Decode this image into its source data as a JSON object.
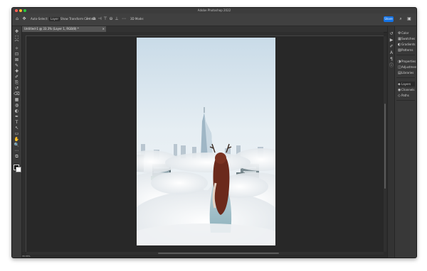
{
  "window": {
    "title": "Adobe Photoshop 2022"
  },
  "options_bar": {
    "left_icons": [
      "home-icon",
      "move-tool-icon"
    ],
    "auto_select_label": "Auto-Select:",
    "layer_value": "Layer",
    "transform_label": "Show Transform Controls",
    "align_icons": [
      "align-left-icon",
      "align-center-icon",
      "align-right-icon",
      "align-top-icon",
      "align-middle-icon",
      "align-bottom-icon",
      "more-icon"
    ],
    "mode_3d_label": "3D Mode:",
    "share_label": "Share",
    "right_icons": [
      "search-icon",
      "workspace-icon"
    ]
  },
  "document_tab": {
    "label": "Untitled-1 @ 33.3% (Layer 1, RGB/8) *",
    "close": "×"
  },
  "tools": [
    "move-tool",
    "marquee-tool",
    "lasso-tool",
    "magic-wand-tool",
    "crop-tool",
    "frame-tool",
    "eyedropper-tool",
    "healing-brush-tool",
    "brush-tool",
    "clone-stamp-tool",
    "history-brush-tool",
    "eraser-tool",
    "gradient-tool",
    "blur-tool",
    "dodge-tool",
    "pen-tool",
    "type-tool",
    "path-selection-tool",
    "rectangle-tool",
    "hand-tool",
    "zoom-tool",
    "edit-toolbar",
    "more-tools"
  ],
  "tool_glyphs": [
    "✥",
    "⬚",
    "⌒",
    "✧",
    "⊡",
    "⊠",
    "✎",
    "✚",
    "✐",
    "⎘",
    "↺",
    "⌫",
    "▦",
    "◍",
    "◐",
    "✒",
    "T",
    "↖",
    "▭",
    "✋",
    "🔍",
    "⋯",
    "⧉"
  ],
  "status": {
    "zoom": "33.33%"
  },
  "panels": {
    "group1": [
      {
        "icon": "⚙",
        "label": "Color"
      },
      {
        "icon": "▦",
        "label": "Swatches"
      },
      {
        "icon": "◐",
        "label": "Gradients"
      },
      {
        "icon": "▨",
        "label": "Patterns"
      }
    ],
    "group2": [
      {
        "icon": "◑",
        "label": "Properties"
      },
      {
        "icon": "◫",
        "label": "Adjustments"
      },
      {
        "icon": "▤",
        "label": "Libraries"
      }
    ],
    "group3": [
      {
        "icon": "◈",
        "label": "Layers"
      },
      {
        "icon": "◉",
        "label": "Channels"
      },
      {
        "icon": "◇",
        "label": "Paths"
      }
    ]
  },
  "dock_icons": [
    "history-icon",
    "actions-icon",
    "brushes-icon",
    "character-icon",
    "paragraph-icon",
    "info-icon"
  ],
  "colors": {
    "accent": "#1473e6",
    "canvas_bg": "#282828",
    "ui_bg": "#383838"
  }
}
